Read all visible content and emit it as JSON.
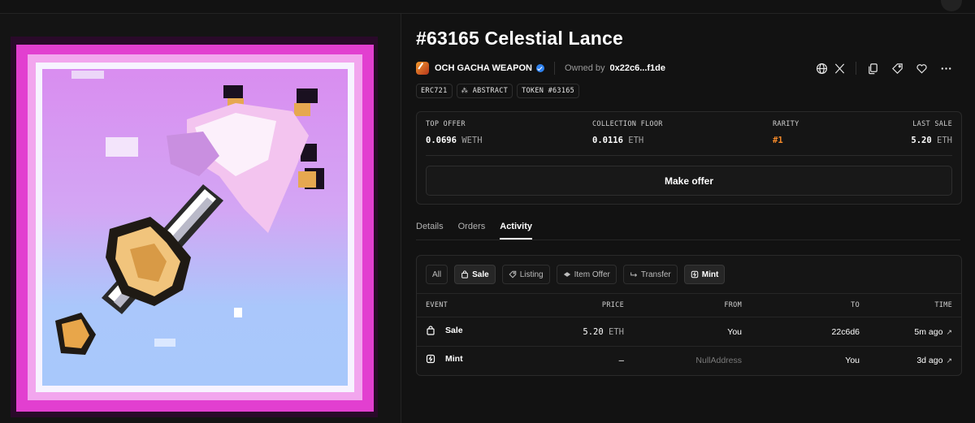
{
  "item": {
    "title": "#63165 Celestial Lance",
    "collection": "OCH GACHA WEAPON",
    "owned_label": "Owned by",
    "owner": "0x22c6...f1de",
    "tags": [
      "ERC721",
      "⁂ ABSTRACT",
      "TOKEN #63165"
    ]
  },
  "actions": [
    "globe-icon",
    "x-icon",
    "copy-icon",
    "tag-icon",
    "heart-icon",
    "more-icon"
  ],
  "stats": {
    "top_offer": {
      "label": "TOP OFFER",
      "value": "0.0696",
      "unit": "WETH"
    },
    "floor": {
      "label": "COLLECTION FLOOR",
      "value": "0.0116",
      "unit": "ETH"
    },
    "rarity": {
      "label": "RARITY",
      "value": "#1"
    },
    "last_sale": {
      "label": "LAST SALE",
      "value": "5.20",
      "unit": "ETH"
    },
    "make_offer_label": "Make offer"
  },
  "tabs": [
    "Details",
    "Orders",
    "Activity"
  ],
  "active_tab": "Activity",
  "filters": {
    "all": "All",
    "sale": "Sale",
    "listing": "Listing",
    "item_offer": "Item Offer",
    "transfer": "Transfer",
    "mint": "Mint"
  },
  "table": {
    "headers": {
      "event": "EVENT",
      "price": "PRICE",
      "from": "FROM",
      "to": "TO",
      "time": "TIME"
    },
    "rows": [
      {
        "event": "Sale",
        "price": "5.20",
        "unit": "ETH",
        "from": "You",
        "to": "22c6d6",
        "time": "5m ago"
      },
      {
        "event": "Mint",
        "price": "–",
        "unit": "",
        "from": "NullAddress",
        "to": "You",
        "time": "3d ago"
      }
    ]
  },
  "colors": {
    "accent_rarity": "#f58a2a",
    "verified": "#2f82ef",
    "frame": "#e23fd0",
    "background": "#121212"
  }
}
